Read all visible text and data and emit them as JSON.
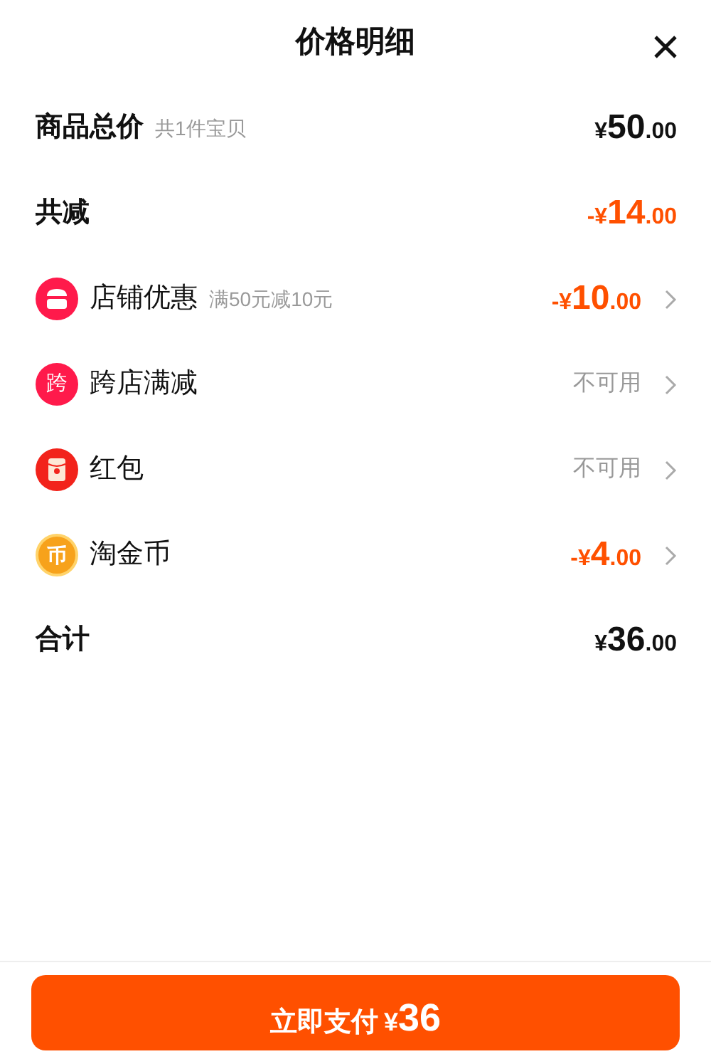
{
  "title": "价格明细",
  "rows": [
    {
      "kind": "summary",
      "label": "商品总价",
      "note": "共1件宝贝",
      "amount": {
        "prefix": "¥",
        "integer": "50",
        "decimal": ".00",
        "discount": false
      }
    },
    {
      "kind": "summary",
      "label": "共减",
      "amount": {
        "prefix": "-¥",
        "integer": "14",
        "decimal": ".00",
        "discount": true
      }
    },
    {
      "kind": "shop",
      "label": "店铺优惠",
      "note": "满50元减10元",
      "amount": {
        "prefix": "-¥",
        "integer": "10",
        "decimal": ".00",
        "discount": true
      }
    },
    {
      "kind": "glyph",
      "icon_text": "跨",
      "label": "跨店满减",
      "status": "不可用"
    },
    {
      "kind": "envelope",
      "label": "红包",
      "status": "不可用"
    },
    {
      "kind": "coin",
      "icon_text": "币",
      "label": "淘金币",
      "amount": {
        "prefix": "-¥",
        "integer": "4",
        "decimal": ".00",
        "discount": true
      }
    },
    {
      "kind": "summary",
      "label": "合计",
      "amount": {
        "prefix": "¥",
        "integer": "36",
        "decimal": ".00",
        "discount": false
      }
    }
  ],
  "pay_button": {
    "label": "立即支付",
    "currency": "¥",
    "amount": "36"
  }
}
